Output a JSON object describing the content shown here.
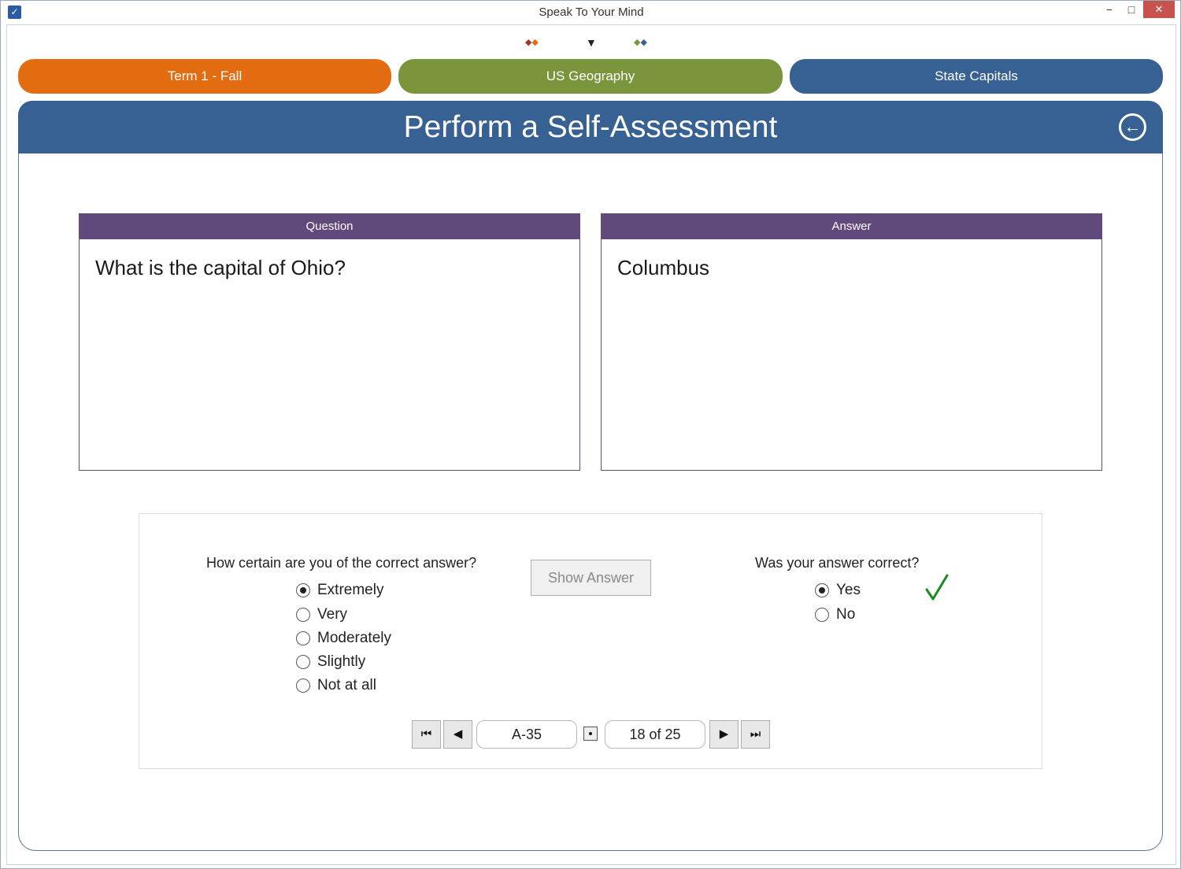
{
  "window": {
    "title": "Speak To Your Mind",
    "minimize_glyph": "−",
    "maximize_glyph": "□",
    "close_glyph": "✕",
    "app_icon_glyph": "✓"
  },
  "indicators": {
    "left_glyph": "◆◆",
    "mid_glyph": "▼",
    "right_glyph": "◆◆",
    "left_colors": [
      "#9b3a2a",
      "#e46c10"
    ],
    "right_colors": [
      "#7a953c",
      "#376093"
    ]
  },
  "tabs": [
    {
      "label": "Term 1 - Fall",
      "color": "#e46c10"
    },
    {
      "label": "US Geography",
      "color": "#7a953c"
    },
    {
      "label": "State Capitals",
      "color": "#376093"
    }
  ],
  "header": {
    "title": "Perform a Self-Assessment",
    "back_icon": "back-arrow-circle-icon",
    "back_glyph": "←"
  },
  "question_card": {
    "heading": "Question",
    "text": "What is the capital of Ohio?"
  },
  "answer_card": {
    "heading": "Answer",
    "text": "Columbus"
  },
  "certainty": {
    "prompt": "How certain are you of the correct answer?",
    "options": [
      {
        "label": "Extremely",
        "selected": true
      },
      {
        "label": "Very",
        "selected": false
      },
      {
        "label": "Moderately",
        "selected": false
      },
      {
        "label": "Slightly",
        "selected": false
      },
      {
        "label": "Not at all",
        "selected": false
      }
    ]
  },
  "show_answer_label": "Show Answer",
  "correctness": {
    "prompt": "Was your answer correct?",
    "options": [
      {
        "label": "Yes",
        "selected": true
      },
      {
        "label": "No",
        "selected": false
      }
    ],
    "check_color": "#1a8a1a"
  },
  "navigation": {
    "first_glyph": "⏮",
    "prev_glyph": "◀",
    "next_glyph": "▶",
    "last_glyph": "⏭",
    "card_code": "A-35",
    "position": "18 of 25"
  }
}
